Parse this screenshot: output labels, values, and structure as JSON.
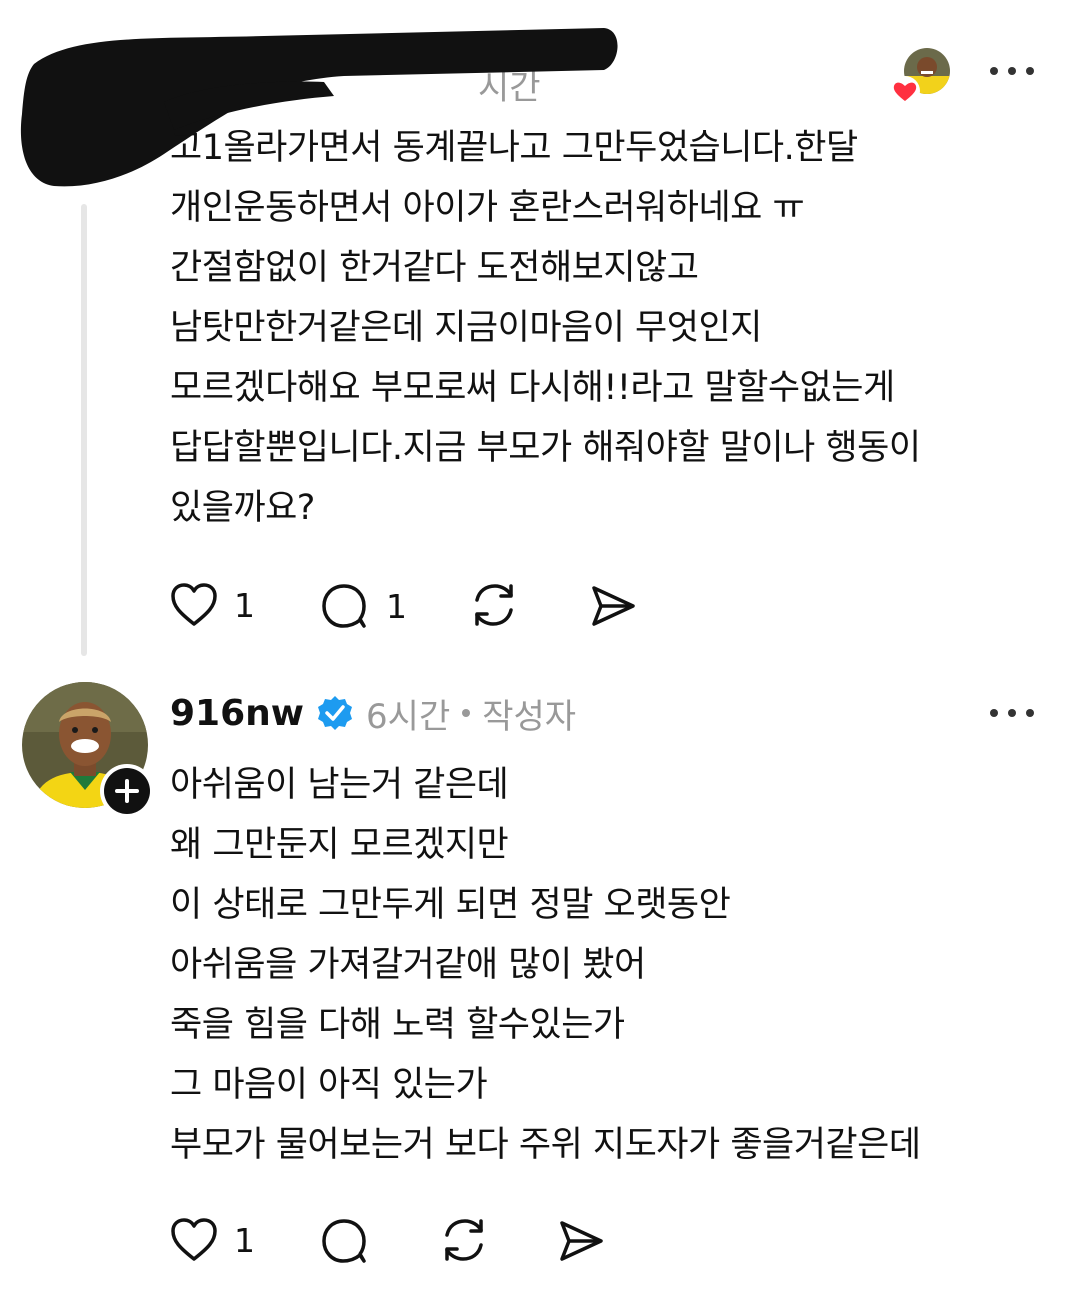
{
  "post1": {
    "time_fragment": "시간",
    "body_lines": [
      "고1올라가면서 동계끝나고 그만두었습니다.한달",
      "개인운동하면서 아이가 혼란스러워하네요 ㅠ",
      "간절함없이 한거같다 도전해보지않고",
      "남탓만한거같은데 지금이마음이 무엇인지",
      "모르겠다해요 부모로써 다시해!!라고 말할수없는게",
      "답답할뿐입니다.지금 부모가 해줘야할 말이나 행동이",
      "있을까요?"
    ],
    "like_count": "1",
    "reply_count": "1"
  },
  "post2": {
    "username": "916nw",
    "time": "6시간",
    "author_tag": "작성자",
    "body_lines": [
      "아쉬움이 남는거 같은데",
      "왜 그만둔지 모르겠지만",
      "이 상태로 그만두게 되면 정말 오랫동안",
      "아쉬움을 가져갈거같애 많이 봤어",
      "죽을 힘을 다해 노력 할수있는가",
      "그 마음이 아직 있는가",
      "부모가 물어보는거 보다 주위 지도자가 좋을거같은데"
    ],
    "like_count": "1"
  },
  "colors": {
    "text": "#111111",
    "muted": "#999999",
    "thread_line": "#e6e6e6",
    "verified_blue": "#1d9bf0",
    "heart_red": "#ff3040",
    "redaction": "#111111"
  },
  "icons": [
    "heart-icon",
    "comment-icon",
    "repost-icon",
    "share-icon",
    "more-icon",
    "verified-badge-icon",
    "follow-plus-icon"
  ]
}
